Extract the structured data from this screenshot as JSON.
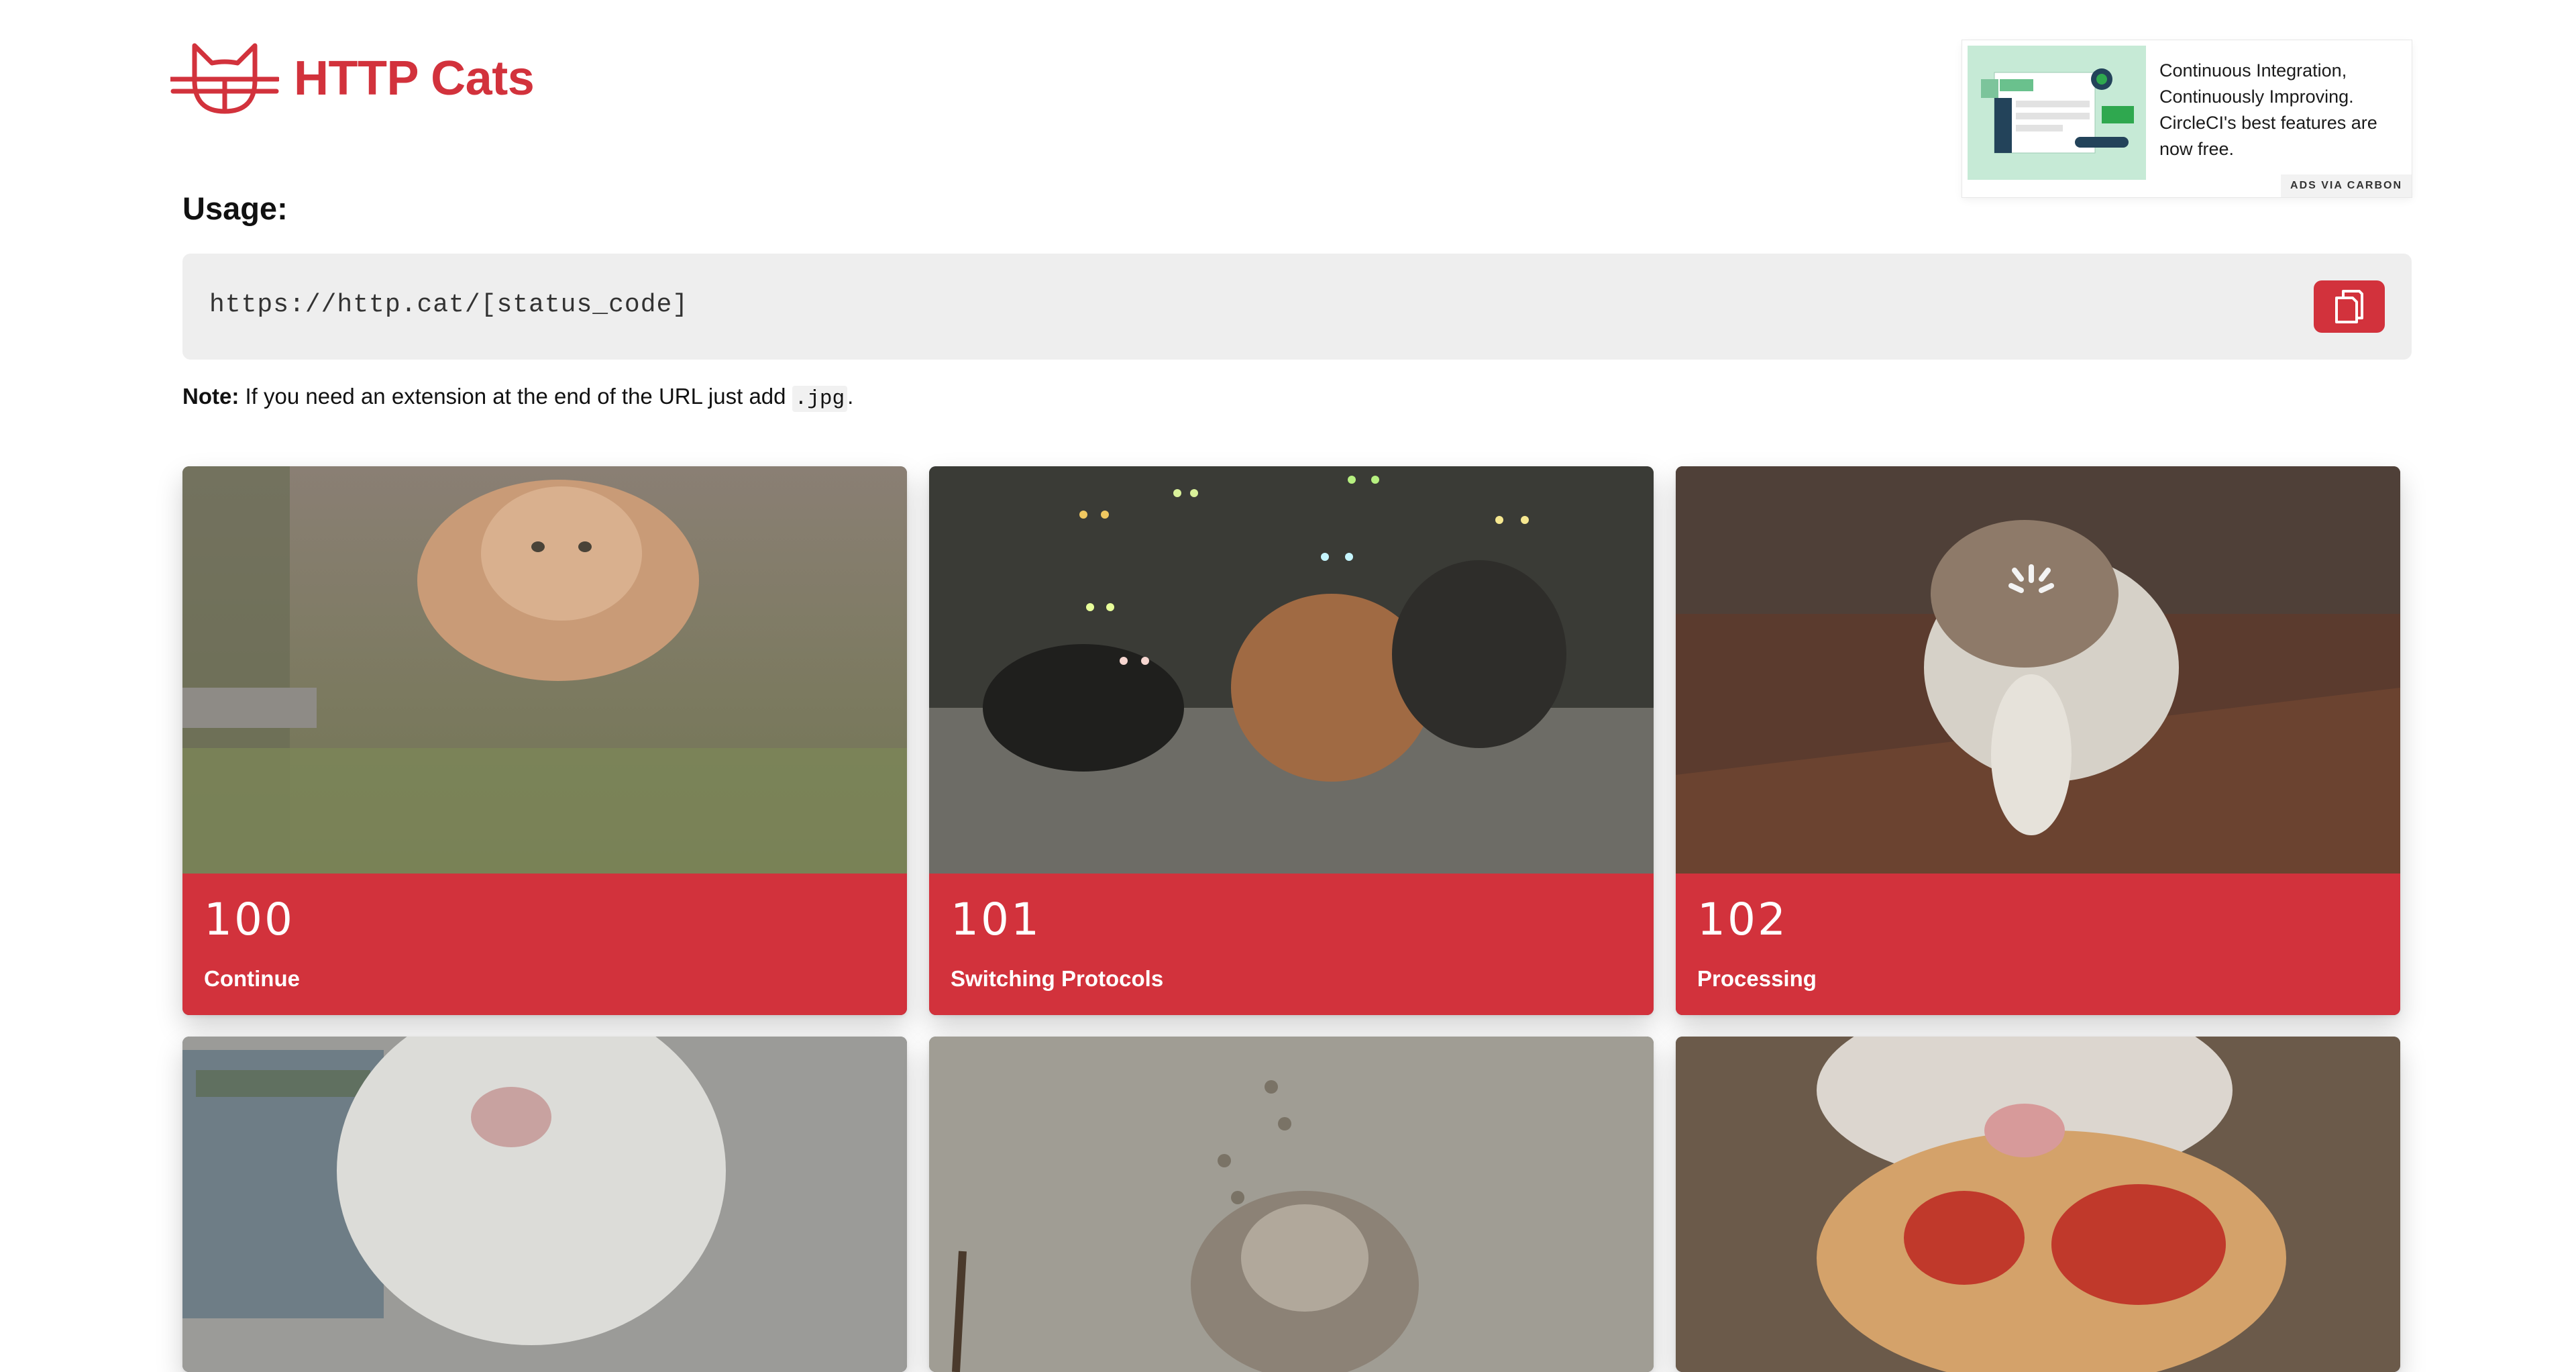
{
  "header": {
    "logo_text": "HTTP Cats",
    "brand_color": "#d2323c"
  },
  "ad": {
    "text": "Continuous Integration, Continuously Improving. CircleCI's best features are now free.",
    "via_label": "ADS VIA CARBON"
  },
  "usage": {
    "title": "Usage:",
    "url": "https://http.cat/[status_code]",
    "copy_icon": "copy-icon",
    "note_label": "Note:",
    "note_text": " If you need an extension at the end of the URL just add ",
    "note_code": ".jpg",
    "note_end": "."
  },
  "cards": [
    {
      "code": "100",
      "label": "Continue"
    },
    {
      "code": "101",
      "label": "Switching Protocols"
    },
    {
      "code": "102",
      "label": "Processing"
    },
    {
      "code": "",
      "label": ""
    },
    {
      "code": "",
      "label": ""
    },
    {
      "code": "",
      "label": ""
    }
  ]
}
